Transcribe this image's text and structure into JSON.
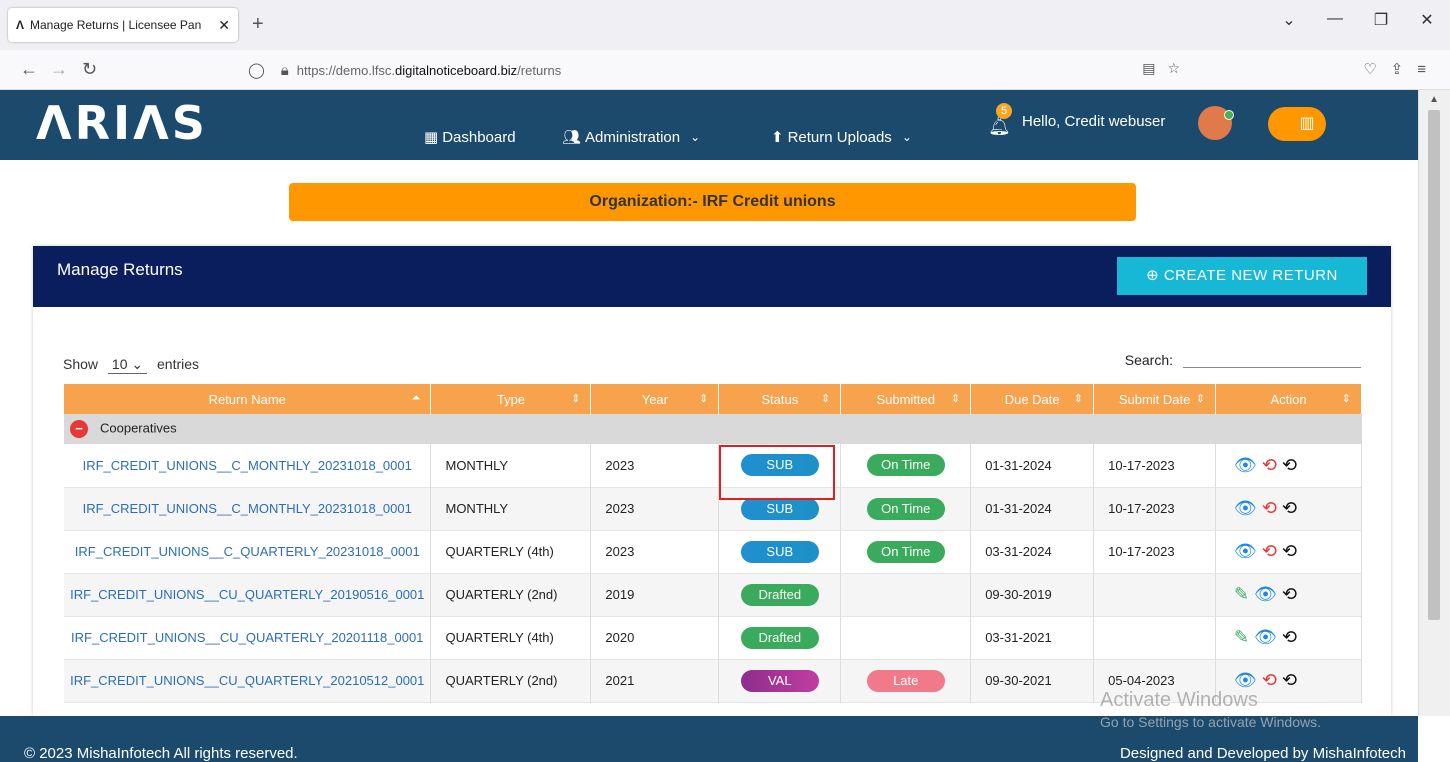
{
  "browser": {
    "tab_title": "Manage Returns | Licensee Pan",
    "url_prefix": "https://demo.lfsc.",
    "url_host": "digitalnoticeboard.biz",
    "url_path": "/returns"
  },
  "header": {
    "logo": "ΛRIΛS",
    "nav": [
      "Dashboard",
      "Administration",
      "Return Uploads"
    ],
    "notification_count": "5",
    "greeting": "Hello, Credit webuser"
  },
  "org_banner": "Organization:- IRF Credit unions",
  "card": {
    "title": "Manage Returns",
    "create_button": "⊕ CREATE NEW RETURN"
  },
  "table_controls": {
    "show": "Show",
    "entries_value": "10",
    "entries": "entries",
    "search_label": "Search:"
  },
  "columns": [
    "Return Name",
    "Type",
    "Year",
    "Status",
    "Submitted",
    "Due Date",
    "Submit Date",
    "Action"
  ],
  "group": "Cooperatives",
  "rows": [
    {
      "name": "IRF_CREDIT_UNIONS__C_MONTHLY_20231018_0001",
      "type": "MONTHLY",
      "year": "2023",
      "status": "SUB",
      "submitted": "On Time",
      "due": "01-31-2024",
      "submit_date": "10-17-2023"
    },
    {
      "name": "IRF_CREDIT_UNIONS__C_MONTHLY_20231018_0001",
      "type": "MONTHLY",
      "year": "2023",
      "status": "SUB",
      "submitted": "On Time",
      "due": "01-31-2024",
      "submit_date": "10-17-2023"
    },
    {
      "name": "IRF_CREDIT_UNIONS__C_QUARTERLY_20231018_0001",
      "type": "QUARTERLY (4th)",
      "year": "2023",
      "status": "SUB",
      "submitted": "On Time",
      "due": "03-31-2024",
      "submit_date": "10-17-2023"
    },
    {
      "name": "IRF_CREDIT_UNIONS__CU_QUARTERLY_20190516_0001",
      "type": "QUARTERLY (2nd)",
      "year": "2019",
      "status": "Drafted",
      "submitted": "",
      "due": "09-30-2019",
      "submit_date": ""
    },
    {
      "name": "IRF_CREDIT_UNIONS__CU_QUARTERLY_20201118_0001",
      "type": "QUARTERLY (4th)",
      "year": "2020",
      "status": "Drafted",
      "submitted": "",
      "due": "03-31-2021",
      "submit_date": ""
    },
    {
      "name": "IRF_CREDIT_UNIONS__CU_QUARTERLY_20210512_0001",
      "type": "QUARTERLY (2nd)",
      "year": "2021",
      "status": "VAL",
      "submitted": "Late",
      "due": "09-30-2021",
      "submit_date": "05-04-2023"
    }
  ],
  "footer": {
    "copyright": "© 2023 MishaInfotech All rights reserved.",
    "designed": "Designed and Developed by MishaInfotech"
  },
  "watermark": {
    "line1": "Activate Windows",
    "line2": "Go to Settings to activate Windows."
  }
}
